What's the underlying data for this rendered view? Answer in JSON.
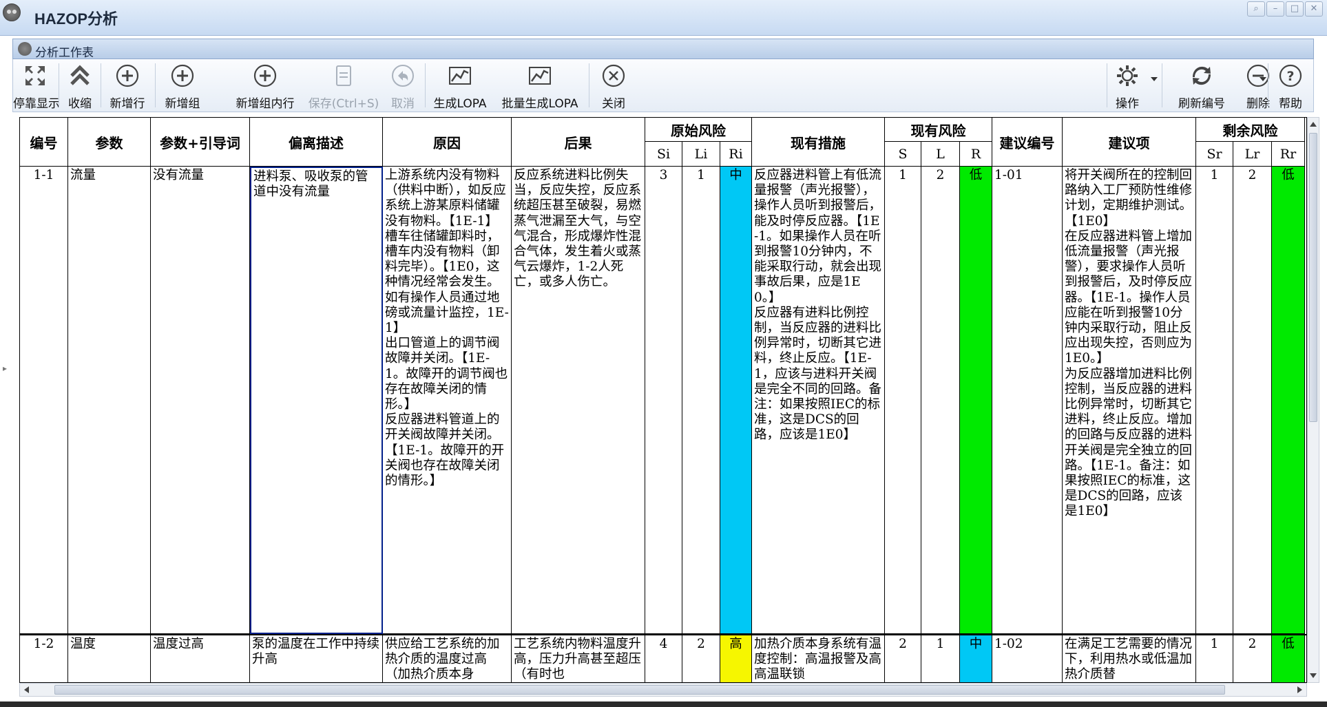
{
  "window": {
    "title": "HAZOP分析"
  },
  "panel": {
    "title": "分析工作表"
  },
  "toolbar": {
    "dock": "停靠显示",
    "collapse": "收缩",
    "add_row": "新增行",
    "add_group": "新增组",
    "add_in_group": "新增组内行",
    "save": "保存(Ctrl+S)",
    "cancel": "取消",
    "gen_lopa": "生成LOPA",
    "batch_lopa": "批量生成LOPA",
    "close": "关闭",
    "operate": "操作",
    "refresh_no": "刷新编号",
    "delete": "删除",
    "help": "帮助"
  },
  "headers": {
    "no": "编号",
    "param": "参数",
    "param_guide": "参数+引导词",
    "deviation": "偏离描述",
    "cause": "原因",
    "consequence": "后果",
    "orig_risk": "原始风险",
    "si": "Si",
    "li": "Li",
    "ri": "Ri",
    "measures": "现有措施",
    "cur_risk": "现有风险",
    "s": "S",
    "l": "L",
    "r": "R",
    "sugg_no": "建议编号",
    "sugg": "建议项",
    "res_risk": "剩余风险",
    "sr": "Sr",
    "lr": "Lr",
    "rr": "Rr"
  },
  "rows": [
    {
      "no": "1-1",
      "param": "流量",
      "param_guide": "没有流量",
      "deviation": "进料泵、吸收泵的管道中没有流量",
      "cause": "上游系统内没有物料（供料中断），如反应系统上游某原料储罐没有物料。【1E-1】\n槽车往储罐卸料时，槽车内没有物料（卸料完毕）。【1E0，这种情况经常会发生。如有操作人员通过地磅或流量计监控，1E-1】\n出口管道上的调节阀故障并关闭。【1E-1。故障开的调节阀也存在故障关闭的情形。】\n反应器进料管道上的开关阀故障并关闭。【1E-1。故障开的开关阀也存在故障关闭的情形。】",
      "consequence": "反应系统进料比例失当，反应失控，反应系统超压甚至破裂，易燃蒸气泄漏至大气，与空气混合，形成爆炸性混合气体，发生着火或蒸气云爆炸，1-2人死亡，或多人伤亡。",
      "si": "3",
      "li": "1",
      "ri": "中",
      "measures": "反应器进料管上有低流量报警（声光报警），操作人员听到报警后，能及时停反应器。【1E-1。如果操作人员在听到报警10分钟内，不能采取行动，就会出现事故后果，应是1E0。】\n反应器有进料比例控制，当反应器的进料比例异常时，切断其它进料，终止反应。【1E-1，应该与进料开关阀是完全不同的回路。备注：如果按照IEC的标准，这是DCS的回路，应该是1E0】",
      "s": "1",
      "l": "2",
      "r": "低",
      "sugg_no": "1-01",
      "sugg": "将开关阀所在的控制回路纳入工厂预防性维修计划，定期维护测试。【1E0】\n在反应器进料管上增加低流量报警（声光报警），要求操作人员听到报警后，及时停反应器。【1E-1。操作人员应能在听到报警10分钟内采取行动，阻止反应出现失控，否则应为1E0。】\n为反应器增加进料比例控制，当反应器的进料比例异常时，切断其它进料，终止反应。增加的回路与反应器的进料开关阀是完全独立的回路。【1E-1。备注：如果按照IEC的标准，这是DCS的回路，应该是1E0】",
      "sr": "1",
      "lr": "2",
      "rr": "低"
    },
    {
      "no": "1-2",
      "param": "温度",
      "param_guide": "温度过高",
      "deviation": "泵的温度在工作中持续升高",
      "cause": "供应给工艺系统的加热介质的温度过高（加热介质本身",
      "consequence": "工艺系统内物料温度升高，压力升高甚至超压（有时也",
      "si": "4",
      "li": "2",
      "ri": "高",
      "measures": "加热介质本身系统有温度控制：高温报警及高高温联锁",
      "s": "2",
      "l": "1",
      "r": "中",
      "sugg_no": "1-02",
      "sugg": "在满足工艺需要的情况下，利用热水或低温加热介质替",
      "sr": "1",
      "lr": "2",
      "rr": "低"
    }
  ],
  "colors": {
    "risk_low": "#00ea00",
    "risk_mid": "#00c8f5",
    "risk_high": "#f6f600",
    "selection_border": "#001f8a"
  }
}
